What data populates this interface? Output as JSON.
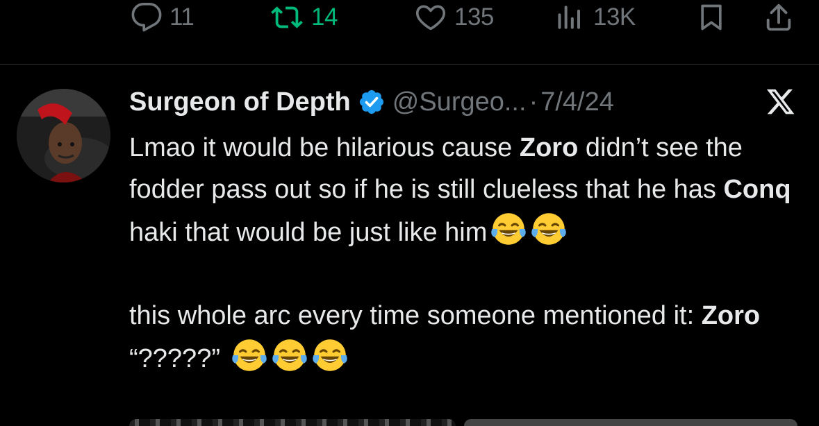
{
  "actions": {
    "reply": {
      "icon": "reply-icon",
      "count": "11"
    },
    "retweet": {
      "icon": "retweet-icon",
      "count": "14"
    },
    "like": {
      "icon": "heart-icon",
      "count": "135"
    },
    "views": {
      "icon": "views-icon",
      "count": "13K"
    },
    "bookmark": {
      "icon": "bookmark-icon"
    },
    "share": {
      "icon": "share-icon"
    }
  },
  "tweet": {
    "display_name": "Surgeon of Depth",
    "handle": "@Surgeo...",
    "separator": "·",
    "date": "7/4/24",
    "source_logo": "x-logo-icon",
    "paragraph1": {
      "t1": "Lmao it would be hilarious cause ",
      "b1": "Zoro",
      "t2": " didn’t see the fodder pass out so if he is still clueless that he has ",
      "b2": "Conq",
      "t3": " haki that would be just like him"
    },
    "paragraph2": {
      "t1": "this whole arc every time someone mentioned it:  ",
      "b1": "Zoro",
      "t2": " “?????” "
    },
    "emoji": "face-with-tears-of-joy"
  },
  "colors": {
    "background": "#000000",
    "text": "#e7e9ea",
    "muted": "#71767b",
    "retweet": "#00ba7c",
    "verified": "#1d9bf0"
  }
}
